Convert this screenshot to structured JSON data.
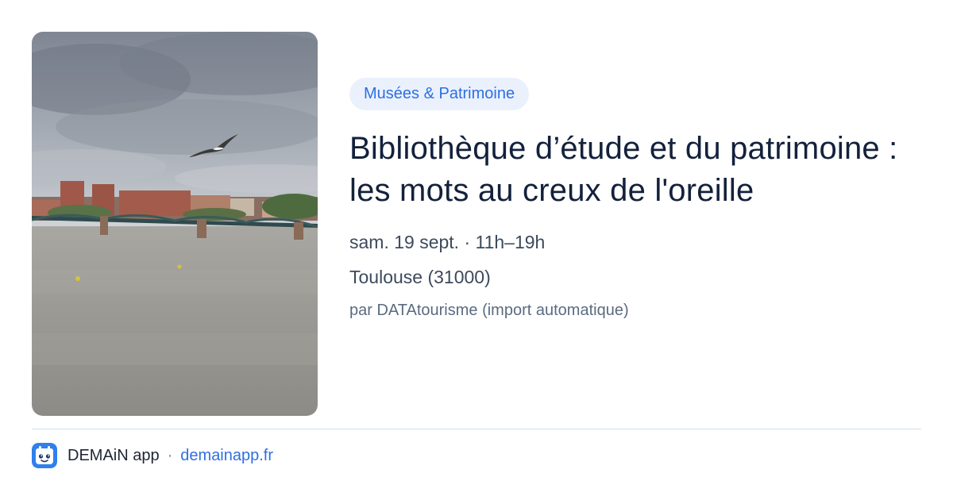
{
  "event": {
    "category": "Musées & Patrimoine",
    "title": "Bibliothèque d’étude et du patrimoine : les mots au creux de l'oreille",
    "datetime": "sam. 19 sept. · 11h–19h",
    "location": "Toulouse (31000)",
    "source": "par DATAtourisme (import automatique)"
  },
  "footer": {
    "app_name": "DEMAiN app",
    "separator": "·",
    "site": "demainapp.fr"
  },
  "colors": {
    "accent": "#2f6fe0",
    "badge_bg": "#eaf1fd",
    "title": "#13213b"
  },
  "icons": {
    "app": "demain-logo-icon"
  }
}
